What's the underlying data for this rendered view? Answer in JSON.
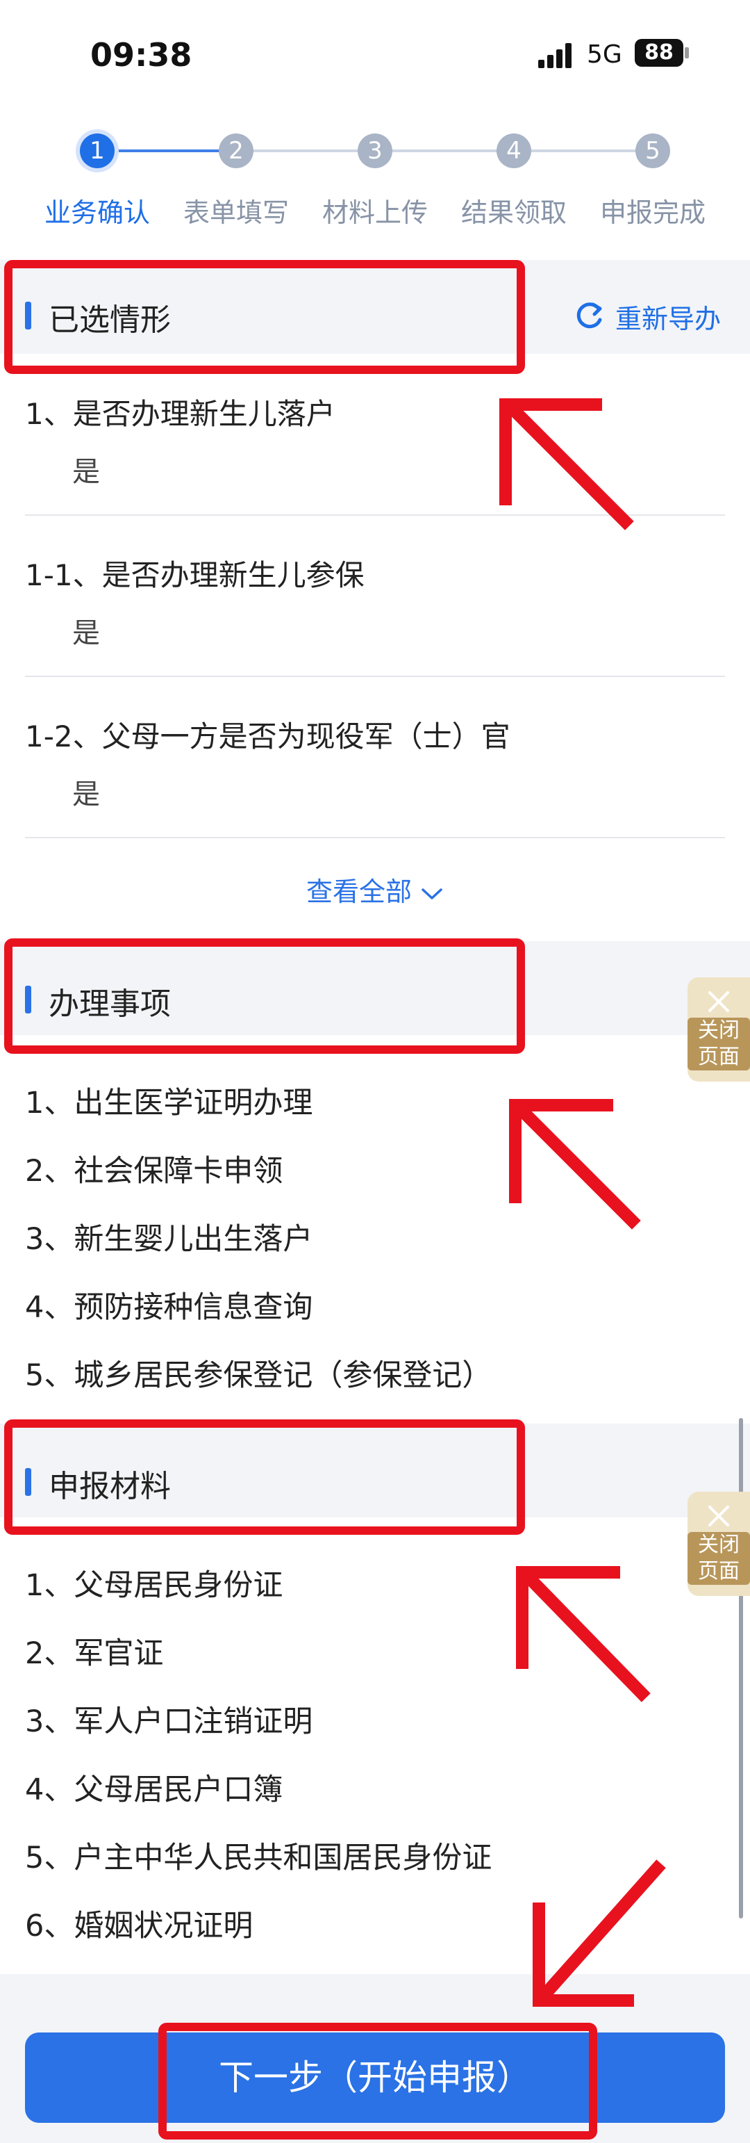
{
  "status_bar": {
    "time": "09:38",
    "network": "5G",
    "battery": "88"
  },
  "steps": [
    {
      "num": "1",
      "label": "业务确认",
      "active": true
    },
    {
      "num": "2",
      "label": "表单填写",
      "active": false
    },
    {
      "num": "3",
      "label": "材料上传",
      "active": false
    },
    {
      "num": "4",
      "label": "结果领取",
      "active": false
    },
    {
      "num": "5",
      "label": "申报完成",
      "active": false
    }
  ],
  "selected_section": {
    "title": "已选情形",
    "redo_label": "重新导办",
    "items": [
      {
        "question": "1、是否办理新生儿落户",
        "answer": "是"
      },
      {
        "question": "1-1、是否办理新生儿参保",
        "answer": "是"
      },
      {
        "question": "1-2、父母一方是否为现役军（士）官",
        "answer": "是"
      }
    ],
    "view_all": "查看全部"
  },
  "matters_section": {
    "title": "办理事项",
    "items": [
      "1、出生医学证明办理",
      "2、社会保障卡申领",
      "3、新生婴儿出生落户",
      "4、预防接种信息查询",
      "5、城乡居民参保登记（参保登记）"
    ]
  },
  "materials_section": {
    "title": "申报材料",
    "items": [
      "1、父母居民身份证",
      "2、军官证",
      "3、军人户口注销证明",
      "4、父母居民户口簿",
      "5、户主中华人民共和国居民身份证",
      "6、婚姻状况证明"
    ]
  },
  "close_tab": {
    "line1": "关闭",
    "line2": "页面"
  },
  "next_button": "下一步（开始申报）",
  "colors": {
    "accent": "#2a72e6",
    "annotation_red": "#e8121f"
  }
}
